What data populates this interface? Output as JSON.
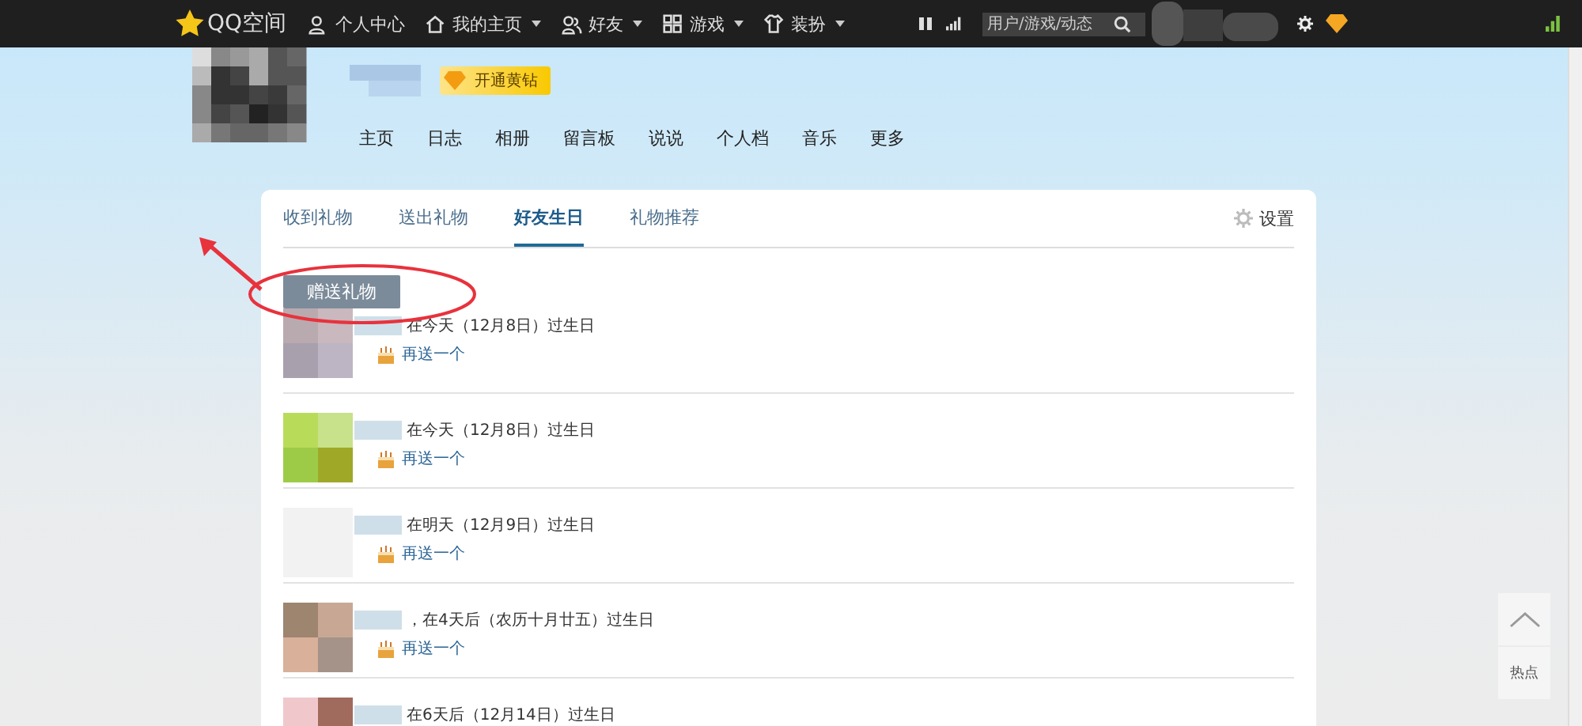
{
  "top_bar": {
    "logo": "QQ空间",
    "menu": [
      {
        "label": "个人中心",
        "dropdown": false
      },
      {
        "label": "我的主页",
        "dropdown": true
      },
      {
        "label": "好友",
        "dropdown": true
      },
      {
        "label": "游戏",
        "dropdown": true
      },
      {
        "label": "装扮",
        "dropdown": true
      }
    ],
    "search": {
      "placeholder": "用户/游戏/动态"
    }
  },
  "profile": {
    "vip_badge": "开通黄钻",
    "nav": [
      {
        "label": "主页"
      },
      {
        "label": "日志"
      },
      {
        "label": "相册"
      },
      {
        "label": "留言板"
      },
      {
        "label": "说说"
      },
      {
        "label": "个人档"
      },
      {
        "label": "音乐"
      },
      {
        "label": "更多"
      }
    ]
  },
  "tabs": [
    {
      "label": "收到礼物",
      "selected": false
    },
    {
      "label": "送出礼物",
      "selected": false
    },
    {
      "label": "好友生日",
      "selected": true
    },
    {
      "label": "礼物推荐",
      "selected": false
    }
  ],
  "settings": "设置",
  "send_button": "赠送礼物",
  "birthdays": [
    {
      "text": "在今天（12月8日）过生日",
      "link": "再送一个"
    },
    {
      "text": "在今天（12月8日）过生日",
      "link": "再送一个"
    },
    {
      "text": "在明天（12月9日）过生日",
      "link": "再送一个"
    },
    {
      "text": "，在4天后（农历十月廿五）过生日",
      "link": "再送一个"
    },
    {
      "text": "在6天后（12月14日）过生日"
    }
  ],
  "side_tools": [
    {
      "kind": "top"
    },
    {
      "kind": "text",
      "label": "热点"
    }
  ]
}
